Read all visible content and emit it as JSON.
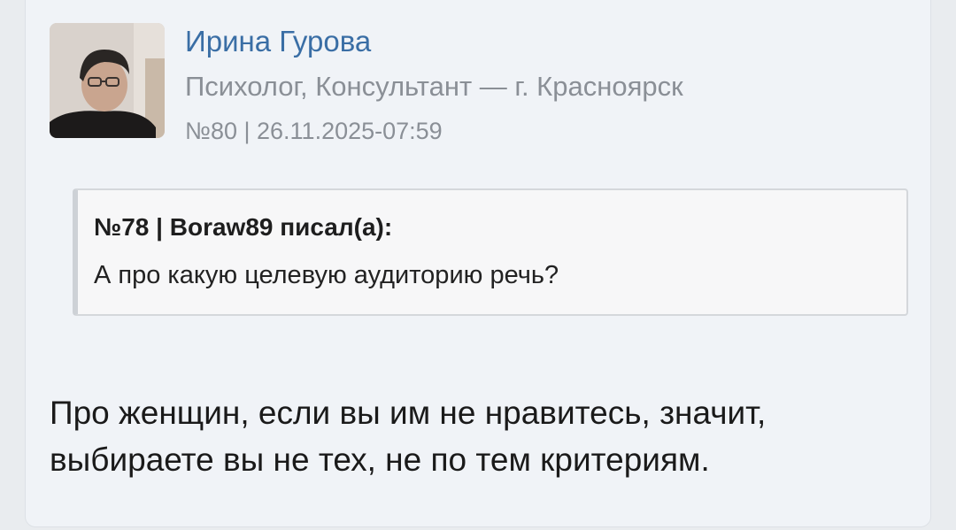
{
  "post": {
    "author": {
      "name": "Ирина Гурова",
      "role": "Психолог, Консультант — г. Красноярск",
      "avatar_icon": "user-photo"
    },
    "meta": "№80 | 26.11.2025-07:59",
    "quote": {
      "header": "№78 | Boraw89 писал(а):",
      "text": "А про какую целевую аудиторию речь?"
    },
    "message": "Про женщин, если вы им не нравитесь, значит, выбираете вы не тех, не по тем критериям."
  },
  "colors": {
    "author_name": "#3a6ea5",
    "meta_text": "#8a8f96",
    "card_background": "#f0f3f7"
  }
}
